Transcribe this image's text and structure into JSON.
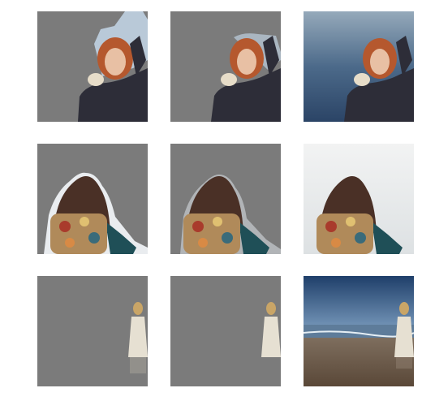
{
  "grid": {
    "rows": [
      {
        "subject": "woman-portrait",
        "cells": [
          {
            "kind": "mask-coarse",
            "background": "#7b7b7b"
          },
          {
            "kind": "mask-refined",
            "background": "#7b7b7b"
          },
          {
            "kind": "composite",
            "background": "water"
          }
        ]
      },
      {
        "subject": "backpack-back-view",
        "cells": [
          {
            "kind": "mask-coarse",
            "background": "#7b7b7b"
          },
          {
            "kind": "mask-refined",
            "background": "#7b7b7b"
          },
          {
            "kind": "composite",
            "background": "pale-sky"
          }
        ]
      },
      {
        "subject": "white-dress-figure",
        "cells": [
          {
            "kind": "mask-coarse",
            "background": "#7b7b7b"
          },
          {
            "kind": "mask-refined",
            "background": "#7b7b7b"
          },
          {
            "kind": "composite",
            "background": "beach"
          }
        ]
      }
    ]
  },
  "colors": {
    "mask_gray": "#7b7b7b",
    "hair_red": "#b5582e",
    "jacket_dark": "#2d2d38",
    "halo": "#b9c9d8",
    "hair_brown": "#4a3026",
    "teal_jacket": "#1f4f57",
    "dress_white": "#e6e0d2",
    "hair_blonde": "#c9a567",
    "sea_blue": "#3d5b7a",
    "sky_pale": "#e9ecee",
    "beach_sand": "#6b5a48"
  }
}
